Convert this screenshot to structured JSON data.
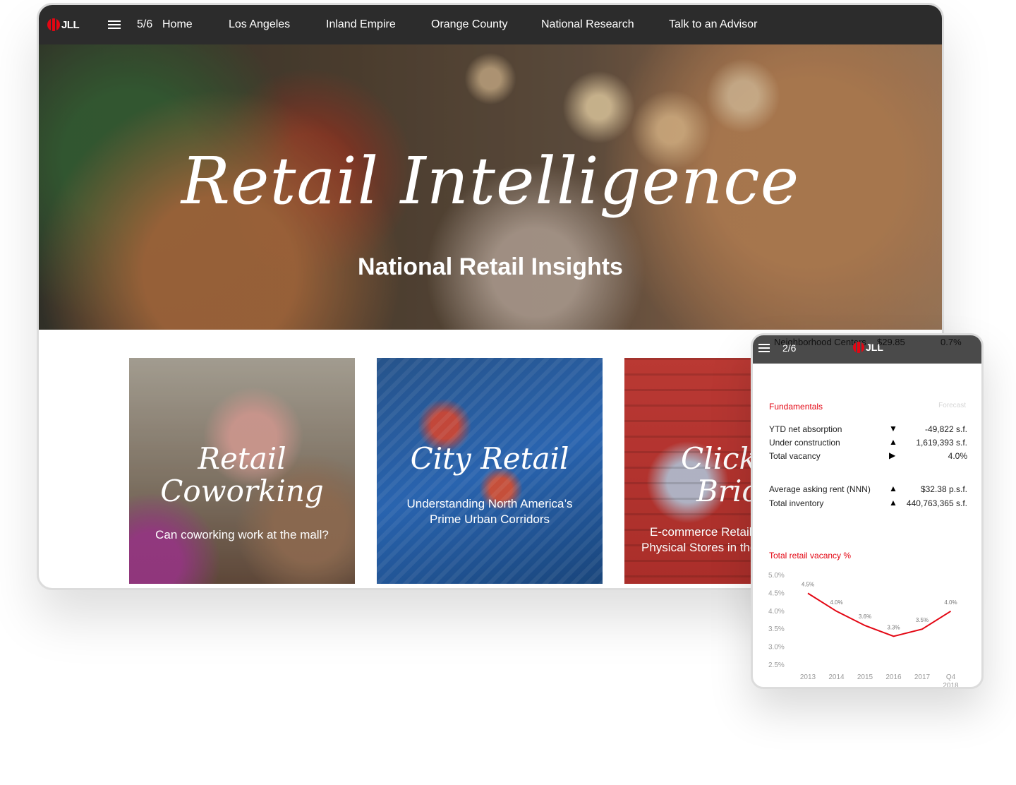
{
  "desktop": {
    "logo_text": "JLL",
    "pager": "5/6",
    "nav": [
      "Home",
      "Los Angeles",
      "Inland Empire",
      "Orange County",
      "National Research",
      "Talk to an Advisor"
    ],
    "hero_title": "Retail Intelligence",
    "hero_subtitle": "National Retail Insights",
    "cards": [
      {
        "title_line1": "Retail",
        "title_line2": "Coworking",
        "subtitle_line1": "Can coworking work at the mall?",
        "subtitle_line2": ""
      },
      {
        "title_line1": "City Retail",
        "title_line2": "",
        "subtitle_line1": "Understanding North America’s",
        "subtitle_line2": "Prime Urban Corridors"
      },
      {
        "title_line1": "Clicks",
        "title_line2": "Bricks",
        "subtitle_line1": "E-commerce Retail",
        "subtitle_line2": "Physical Stores in the"
      }
    ]
  },
  "phone": {
    "pager": "2/6",
    "logo_text": "JLL",
    "ghost_row": {
      "label": "Neighborhood Centers",
      "rent": "$29.85",
      "pct": "0.7%"
    },
    "section_title": "Fundamentals",
    "forecast_label": "Forecast",
    "metrics": [
      {
        "label": "YTD net absorption",
        "arrow": "▼",
        "value": "-49,822 s.f."
      },
      {
        "label": "Under construction",
        "arrow": "▲",
        "value": "1,619,393 s.f."
      },
      {
        "label": "Total vacancy",
        "arrow": "▶",
        "value": "4.0%"
      },
      {
        "label": "Average asking rent (NNN)",
        "arrow": "▲",
        "value": "$32.38 p.s.f."
      },
      {
        "label": "Total inventory",
        "arrow": "▲",
        "value": "440,763,365 s.f."
      }
    ],
    "chart_title": "Total retail vacancy %"
  },
  "colors": {
    "accent": "#e30613",
    "navbar": "#2c2c2c",
    "phone_bar": "#4a4a4a",
    "line": "#e30613"
  },
  "chart_data": {
    "type": "line",
    "title": "Total retail vacancy %",
    "categories": [
      "2013",
      "2014",
      "2015",
      "2016",
      "2017",
      "Q4 2018"
    ],
    "series": [
      {
        "values": [
          4.5,
          4.0,
          3.6,
          3.3,
          3.5,
          4.0
        ]
      }
    ],
    "data_labels": [
      "4.5%",
      "4.0%",
      "3.6%",
      "3.3%",
      "3.5%",
      "4.0%"
    ],
    "y_ticks": [
      "5.0%",
      "4.5%",
      "4.0%",
      "3.5%",
      "3.0%",
      "2.5%"
    ],
    "ylim": [
      2.5,
      5.0
    ],
    "grid": false
  }
}
